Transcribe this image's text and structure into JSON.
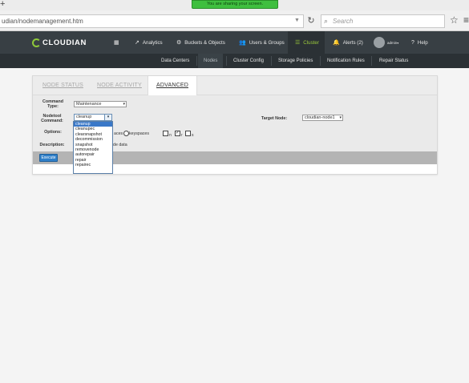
{
  "browser": {
    "sharing_banner": "You are sharing your screen.",
    "url": "udian/nodemanagement.htm",
    "search_placeholder": "Search"
  },
  "app": {
    "logo_text": "CLOUDIAN",
    "nav": [
      {
        "label": "Analytics",
        "icon": "chart-line-icon"
      },
      {
        "label": "Buckets & Objects",
        "icon": "gear-icon"
      },
      {
        "label": "Users & Groups",
        "icon": "users-icon"
      },
      {
        "label": "Cluster",
        "icon": "list-icon",
        "active": true
      },
      {
        "label": "Alerts (2)",
        "icon": "bell-icon"
      },
      {
        "label": "admin",
        "icon": "avatar"
      },
      {
        "label": "Help",
        "icon": "help-icon"
      }
    ],
    "subnav": [
      "Data Centers",
      "Nodes",
      "Cluster Config",
      "Storage Policies",
      "Notification Rules",
      "Repair Status"
    ],
    "active_subnav": "Nodes"
  },
  "panel": {
    "tabs": [
      "NODE STATUS",
      "NODE ACTIVITY",
      "ADVANCED"
    ],
    "active_tab": "ADVANCED",
    "labels": {
      "command_type": "Command Type:",
      "nodetool_command": "Nodetool Command:",
      "options": "Options:",
      "description": "Description:",
      "target_node": "Target Node:"
    },
    "command_type_value": "Maintenance",
    "nodetool_value": "cleanup",
    "nodetool_options": [
      "cleanup",
      "cleanupec",
      "clearsnapshot",
      "decommission",
      "snapshot",
      "removenode",
      "autorepair",
      "repair",
      "repairec"
    ],
    "selected_option": "cleanup",
    "target_node_value": "cloudian-node1",
    "options_text_partial": "aces",
    "options_radio_label": "keyspaces",
    "checkbox_labels": [
      "n",
      "r",
      "s"
    ],
    "description_partial": "de data",
    "execute_label": "Execute"
  }
}
